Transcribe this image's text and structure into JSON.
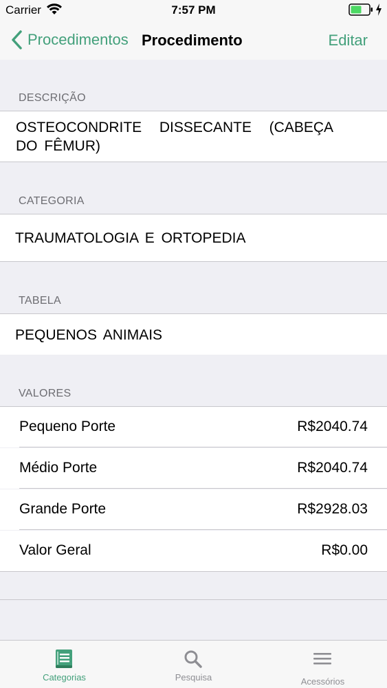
{
  "status": {
    "carrier": "Carrier",
    "time": "7:57 PM",
    "battery_color": "#4cd964"
  },
  "nav": {
    "back_label": "Procedimentos",
    "title": "Procedimento",
    "edit_label": "Editar",
    "accent_color": "#43a07b"
  },
  "sections": {
    "descricao": {
      "header": "DESCRIÇÃO",
      "value": "OSTEOCONDRITE DISSECANTE (CABEÇA DO FÊMUR)"
    },
    "categoria": {
      "header": "CATEGORIA",
      "value": "TRAUMATOLOGIA E ORTOPEDIA"
    },
    "tabela": {
      "header": "TABELA",
      "value": "PEQUENOS ANIMAIS"
    },
    "valores": {
      "header": "VALORES",
      "rows": [
        {
          "label": "Pequeno Porte",
          "value": "R$2040.74"
        },
        {
          "label": "Médio Porte",
          "value": "R$2040.74"
        },
        {
          "label": "Grande Porte",
          "value": "R$2928.03"
        },
        {
          "label": "Valor Geral",
          "value": "R$0.00"
        }
      ]
    }
  },
  "tabs": [
    {
      "label": "Categorias",
      "icon": "book-icon",
      "active": true
    },
    {
      "label": "Pesquisa",
      "icon": "search-icon",
      "active": false
    },
    {
      "label": "Acessórios",
      "icon": "menu-icon",
      "active": false
    }
  ]
}
